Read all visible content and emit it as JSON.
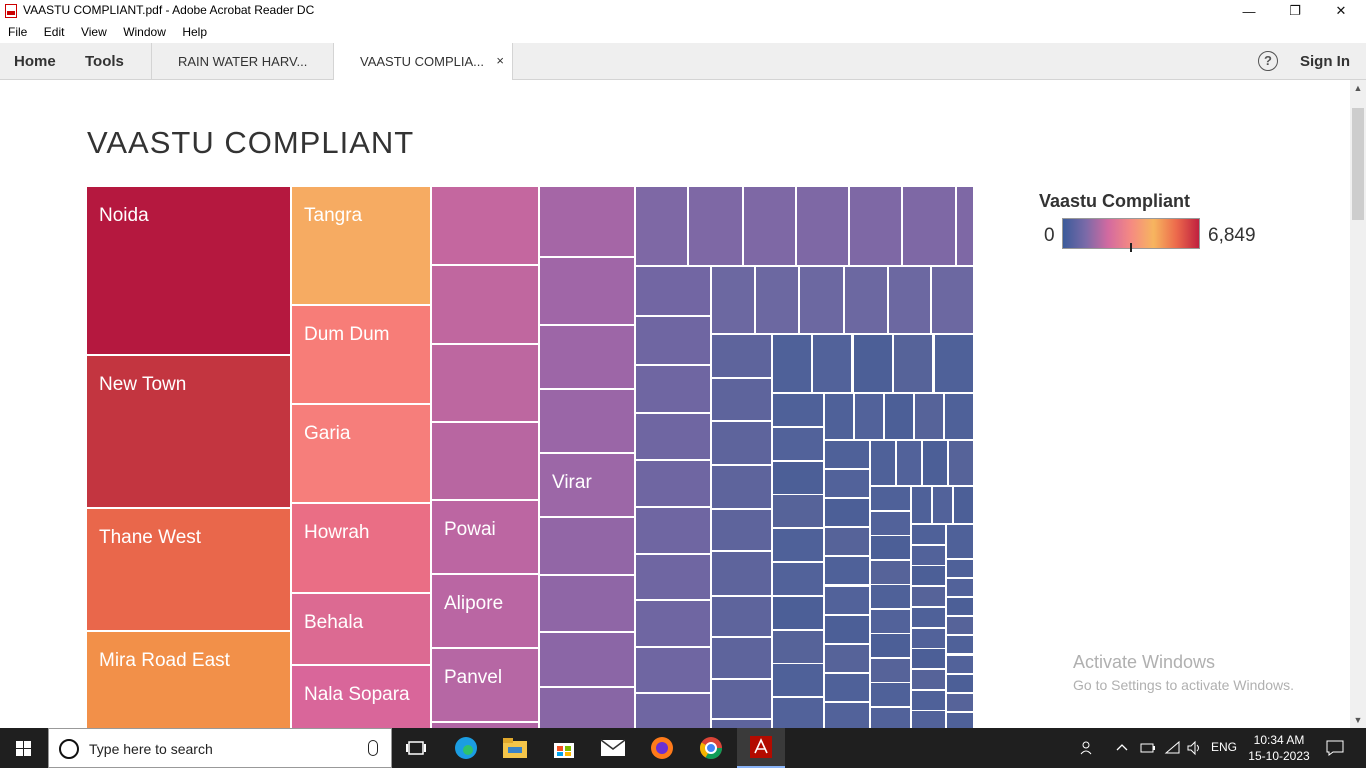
{
  "window": {
    "title": "VAASTU COMPLIANT.pdf - Adobe Acrobat Reader DC",
    "minimize_glyph": "—",
    "maximize_glyph": "❐",
    "close_glyph": "✕"
  },
  "menu": [
    "File",
    "Edit",
    "View",
    "Window",
    "Help"
  ],
  "nav": {
    "home": "Home",
    "tools": "Tools",
    "sign_in": "Sign In",
    "help_glyph": "?"
  },
  "tabs": [
    {
      "label": "RAIN WATER HARV...",
      "active": false
    },
    {
      "label": "VAASTU COMPLIA...",
      "active": true,
      "close": "×"
    }
  ],
  "document": {
    "title": "VAASTU COMPLIANT",
    "legend": {
      "title": "Vaastu Compliant",
      "min": "0",
      "max": "6,849",
      "gradient": [
        "#3b5b9a",
        "#7a6aa8",
        "#d36aa0",
        "#f58a82",
        "#f7b55f",
        "#ec6a4c",
        "#c0203f"
      ]
    }
  },
  "chart_data": {
    "type": "treemap",
    "title": "VAASTU COMPLIANT",
    "color_legend": {
      "label": "Vaastu Compliant",
      "min": 0,
      "max": 6849
    },
    "labeled_cells": [
      {
        "label": "Noida",
        "color": "#b5183f"
      },
      {
        "label": "New Town",
        "color": "#c33540"
      },
      {
        "label": "Thane West",
        "color": "#e9674b"
      },
      {
        "label": "Mira Road East",
        "color": "#f29049"
      },
      {
        "label": "Tangra",
        "color": "#f6ab62"
      },
      {
        "label": "Dum Dum",
        "color": "#f77d78"
      },
      {
        "label": "Garia",
        "color": "#f67e7b"
      },
      {
        "label": "Howrah",
        "color": "#ea6e85"
      },
      {
        "label": "Behala",
        "color": "#dc6a92"
      },
      {
        "label": "Nala Sopara",
        "color": "#d9669a"
      },
      {
        "label": "Powai",
        "color": "#bc66a2"
      },
      {
        "label": "Alipore",
        "color": "#ba66a3"
      },
      {
        "label": "Panvel",
        "color": "#b667a4"
      },
      {
        "label": "Virar",
        "color": "#9c67a7"
      }
    ]
  },
  "overlay": {
    "activate_title": "Activate Windows",
    "activate_sub": "Go to Settings to activate Windows."
  },
  "taskbar": {
    "search_placeholder": "Type here to search",
    "language": "ENG",
    "time": "10:34 AM",
    "date": "15-10-2023"
  }
}
